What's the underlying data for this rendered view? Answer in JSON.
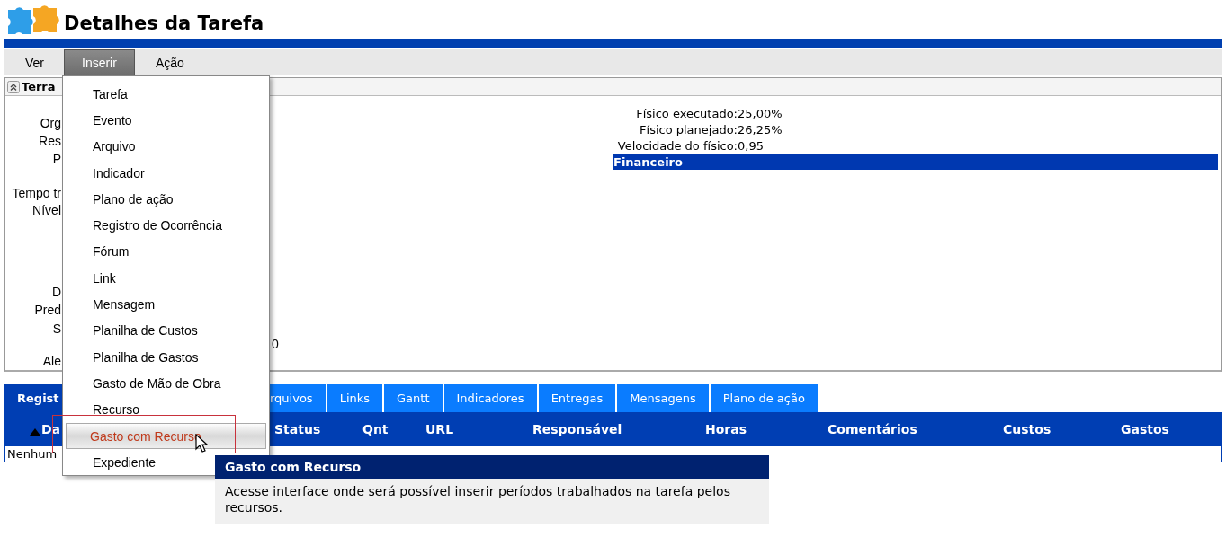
{
  "window": {
    "title": "Detalhes da Tarefa"
  },
  "menubar": [
    {
      "label": "Ver",
      "selected": false
    },
    {
      "label": "Inserir",
      "selected": true
    },
    {
      "label": "Ação",
      "selected": false
    }
  ],
  "panel": {
    "title": "Terra",
    "left_fields": [
      {
        "label": "Org"
      },
      {
        "label": "Res"
      },
      {
        "label": "P"
      },
      {
        "label": "Tempo tr"
      },
      {
        "label": "Nível"
      },
      {
        "label": "D"
      },
      {
        "label": "Pred"
      },
      {
        "label": "S"
      },
      {
        "label": "Ale"
      }
    ],
    "value_fragment": "0",
    "right_fields": [
      {
        "label": "Físico executado:",
        "value": "25,00%"
      },
      {
        "label": "Físico planejado:",
        "value": "26,25%"
      },
      {
        "label": "Velocidade do físico:",
        "value": "0,95"
      }
    ],
    "section_header": "Financeiro"
  },
  "tabs": [
    {
      "label": "Regist",
      "selected": true
    },
    {
      "label": "rquivos",
      "selected": false
    },
    {
      "label": "Links",
      "selected": false
    },
    {
      "label": "Gantt",
      "selected": false
    },
    {
      "label": "Indicadores",
      "selected": false
    },
    {
      "label": "Entregas",
      "selected": false
    },
    {
      "label": "Mensagens",
      "selected": false
    },
    {
      "label": "Plano de ação",
      "selected": false
    }
  ],
  "table": {
    "columns": [
      "Da",
      "Status",
      "Qnt",
      "URL",
      "Responsável",
      "Horas",
      "Comentários",
      "Custos",
      "Gastos"
    ],
    "empty_text": "Nenhum"
  },
  "dropdown": {
    "items": [
      {
        "label": "Tarefa",
        "selected": false
      },
      {
        "label": "Evento",
        "selected": false
      },
      {
        "label": "Arquivo",
        "selected": false
      },
      {
        "label": "Indicador",
        "selected": false
      },
      {
        "label": "Plano de ação",
        "selected": false
      },
      {
        "label": "Registro de Ocorrência",
        "selected": false
      },
      {
        "label": "Fórum",
        "selected": false
      },
      {
        "label": "Link",
        "selected": false
      },
      {
        "label": "Mensagem",
        "selected": false
      },
      {
        "label": "Planilha de Custos",
        "selected": false
      },
      {
        "label": "Planilha de Gastos",
        "selected": false
      },
      {
        "label": "Gasto de Mão de Obra",
        "selected": false
      },
      {
        "label": "Recurso",
        "selected": false
      },
      {
        "label": "Gasto com Recurso",
        "selected": true
      },
      {
        "label": "Expediente",
        "selected": false
      }
    ]
  },
  "tooltip": {
    "title": "Gasto com Recurso",
    "text": "Acesse interface onde será possível inserir períodos trabalhados na tarefa pelos recursos."
  }
}
